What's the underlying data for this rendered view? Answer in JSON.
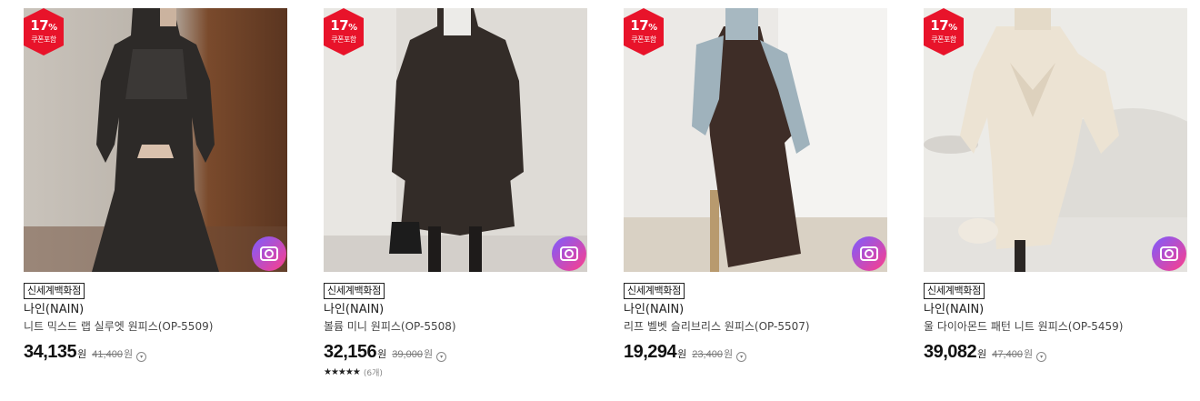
{
  "badge_note": "쿠폰포함",
  "store_label": "신세계백화점",
  "currency": "원",
  "products": [
    {
      "discount": "17",
      "brand": "나인(NAIN)",
      "name": "니트 믹스드 랩 실루엣 원피스(OP-5509)",
      "price": "34,135",
      "original_price": "41,400",
      "stars": "",
      "review_count": ""
    },
    {
      "discount": "17",
      "brand": "나인(NAIN)",
      "name": "볼륨 미니 원피스(OP-5508)",
      "price": "32,156",
      "original_price": "39,000",
      "stars": "★★★★★",
      "review_count": "(6개)"
    },
    {
      "discount": "17",
      "brand": "나인(NAIN)",
      "name": "리프 벨벳 슬리브리스 원피스(OP-5507)",
      "price": "19,294",
      "original_price": "23,400",
      "stars": "",
      "review_count": ""
    },
    {
      "discount": "17",
      "brand": "나인(NAIN)",
      "name": "울 다이아몬드 패턴 니트 원피스(OP-5459)",
      "price": "39,082",
      "original_price": "47,400",
      "stars": "",
      "review_count": ""
    }
  ],
  "colors": {
    "badge_red": "#e8132a",
    "camera_gradient_start": "#7b5cff",
    "camera_gradient_end": "#ff3e8a"
  },
  "icons": {
    "review_camera": "camera-icon",
    "price_info": "chevron-down-circle-icon"
  }
}
